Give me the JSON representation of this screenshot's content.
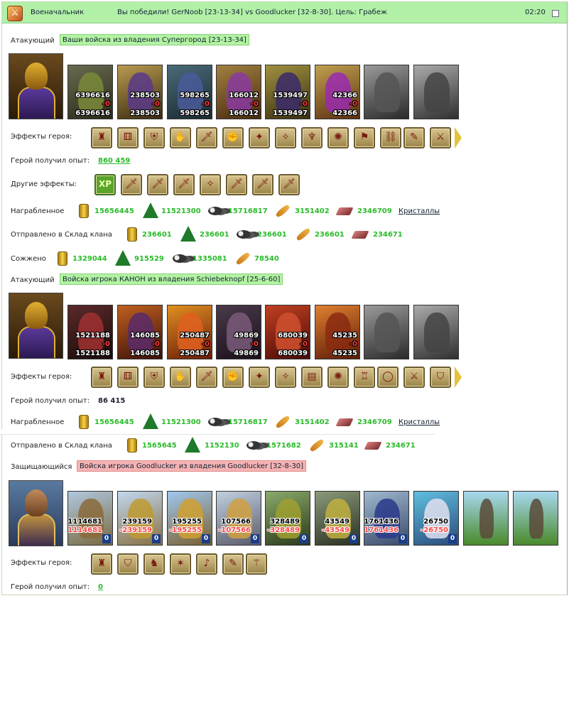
{
  "title_bar": {
    "icon": "crossed-swords-icon",
    "name": "Военачальник",
    "result": "Вы победили! GerNoob [23-13-34] vs Goodlucker [32-8-30]. Цель: Грабеж",
    "time": "02:20"
  },
  "labels": {
    "attacking": "Атакующий",
    "defending": "Защищающийся",
    "hero_effects": "Эффекты героя:",
    "hero_exp": "Герой получил опыт:",
    "other_effects": "Другие эффекты:",
    "looted": "Награбленное",
    "sent_to_clan": "Отправлено в Склад клана",
    "burned": "Сожжено",
    "crystals": "Кристаллы"
  },
  "army1": {
    "tag": "Ваши войска из владения Супергород [23-13-34]",
    "units": [
      {
        "top": "6396616",
        "loss": "-0",
        "bottom": "6396616"
      },
      {
        "top": "238503",
        "loss": "-0",
        "bottom": "238503"
      },
      {
        "top": "598265",
        "loss": "-0",
        "bottom": "598265"
      },
      {
        "top": "166012",
        "loss": "-0",
        "bottom": "166012"
      },
      {
        "top": "1539497",
        "loss": "-0",
        "bottom": "1539497"
      },
      {
        "top": "42366",
        "loss": "-0",
        "bottom": "42366"
      }
    ],
    "exp": "860 459",
    "looted": [
      "15656445",
      "11521300",
      "15716817",
      "3151402",
      "2346709"
    ],
    "sent": [
      "236601",
      "236601",
      "236601",
      "236601",
      "234671"
    ],
    "burned": [
      "1329044",
      "915529",
      "1335081",
      "78540"
    ]
  },
  "army2": {
    "tag": "Войска игрока КАНОН из владения Schiebeknopf [25-6-60]",
    "units": [
      {
        "top": "1521188",
        "loss": "-0",
        "bottom": "1521188"
      },
      {
        "top": "146085",
        "loss": "-0",
        "bottom": "146085"
      },
      {
        "top": "250487",
        "loss": "-0",
        "bottom": "250487"
      },
      {
        "top": "49869",
        "loss": "-0",
        "bottom": "49869"
      },
      {
        "top": "680039",
        "loss": "-0",
        "bottom": "680039"
      },
      {
        "top": "45235",
        "loss": "-0",
        "bottom": "45235"
      }
    ],
    "exp": "86 415",
    "looted": [
      "15656445",
      "11521300",
      "15716817",
      "3151402",
      "2346709"
    ],
    "sent": [
      "1565645",
      "1152130",
      "1571682",
      "315141",
      "234671"
    ]
  },
  "army3": {
    "tag": "Войска игрока Goodlucker из владения Goodlucker [32-8-30]",
    "units": [
      {
        "top": "1114681",
        "loss": "-1114681",
        "bottom": "0"
      },
      {
        "top": "239159",
        "loss": "-239159",
        "bottom": "0"
      },
      {
        "top": "195255",
        "loss": "-195255",
        "bottom": "0"
      },
      {
        "top": "107566",
        "loss": "-107566",
        "bottom": "0"
      },
      {
        "top": "328489",
        "loss": "-328489",
        "bottom": "0"
      },
      {
        "top": "43549",
        "loss": "-43549",
        "bottom": "0"
      },
      {
        "top": "1761436",
        "loss": "-1761436",
        "bottom": "0"
      },
      {
        "top": "26750",
        "loss": "-26750",
        "bottom": "0"
      }
    ],
    "exp": "0"
  },
  "effect_glyphs": {
    "xp": "XP"
  }
}
